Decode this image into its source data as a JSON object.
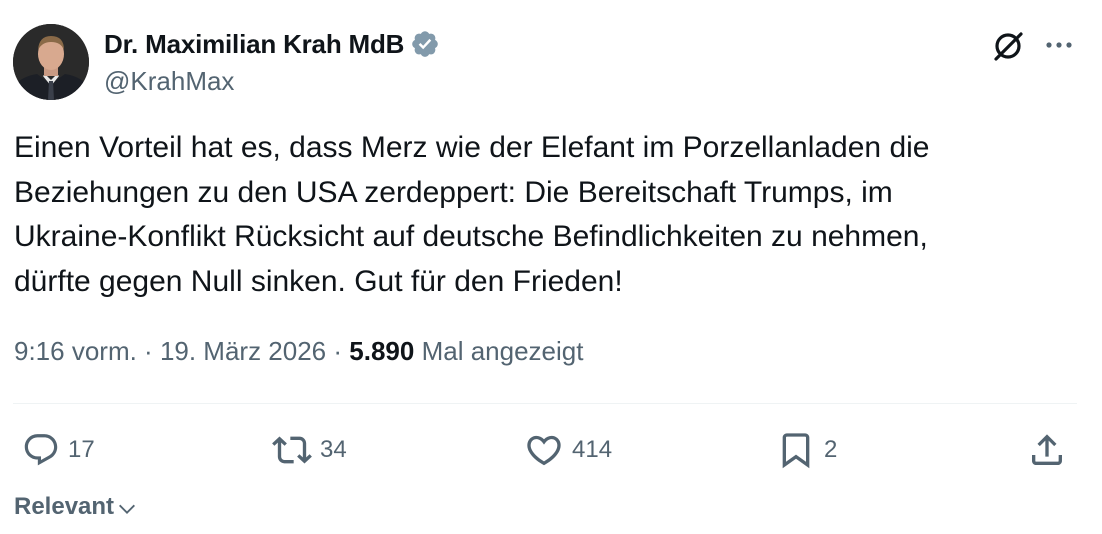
{
  "author": {
    "display_name": "Dr. Maximilian Krah MdB",
    "handle": "@KrahMax",
    "verified_color": "#829aab"
  },
  "tweet": {
    "lines": [
      "Einen Vorteil hat es, dass Merz wie der Elefant im Porzellanladen die",
      "Beziehungen zu den USA zerdeppert: Die Bereitschaft Trumps, im",
      "Ukraine-Konflikt Rücksicht auf deutsche Befindlichkeiten zu nehmen,",
      "dürfte gegen Null sinken. Gut für den Frieden!"
    ],
    "time": "9:16 vorm.",
    "separator": " · ",
    "date": "19. März 2026",
    "views_count": "5.890",
    "views_label": "Mal angezeigt"
  },
  "actions": {
    "replies": "17",
    "reposts": "34",
    "likes": "414",
    "bookmarks": "2"
  },
  "sort": {
    "label": "Relevant"
  },
  "icons": {
    "grok": "grok-icon",
    "more": "more-icon",
    "reply": "reply-icon",
    "repost": "repost-icon",
    "like": "heart-icon",
    "bookmark": "bookmark-icon",
    "share": "share-icon",
    "chevron": "chevron-down-icon"
  },
  "colors": {
    "text_primary": "#0f1419",
    "text_secondary": "#536471",
    "divider": "#eff3f4"
  }
}
